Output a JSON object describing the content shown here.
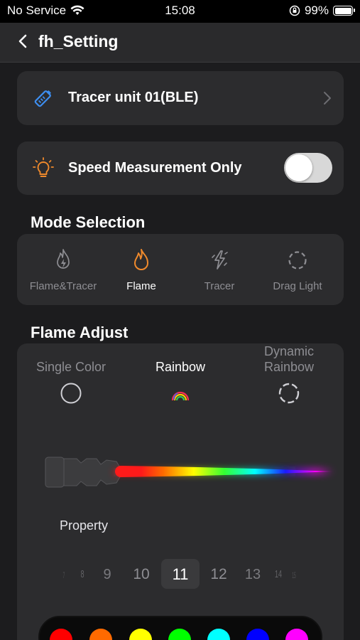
{
  "status_bar": {
    "carrier": "No Service",
    "time": "15:08",
    "battery": "99%"
  },
  "nav": {
    "title": "fh_Setting"
  },
  "device": {
    "name": "Tracer unit 01(BLE)"
  },
  "speed": {
    "label": "Speed Measurement Only",
    "enabled": false
  },
  "mode_section": {
    "title": "Mode Selection"
  },
  "modes": [
    {
      "label": "Flame&Tracer",
      "active": false
    },
    {
      "label": "Flame",
      "active": true
    },
    {
      "label": "Tracer",
      "active": false
    },
    {
      "label": "Drag Light",
      "active": false
    }
  ],
  "flame_section": {
    "title": "Flame Adjust"
  },
  "flame_options": {
    "single": "Single Color",
    "rainbow": "Rainbow",
    "dynamic_line1": "Dynamic",
    "dynamic_line2": "Rainbow",
    "selected": "Rainbow"
  },
  "property": {
    "label": "Property"
  },
  "picker": {
    "values": [
      "7",
      "8",
      "9",
      "10",
      "11",
      "12",
      "13",
      "14",
      "15"
    ],
    "selected": "11"
  },
  "palette": [
    "#ff0000",
    "#ff6a00",
    "#ffff00",
    "#00ff00",
    "#00ffff",
    "#0000ff",
    "#ff00ff"
  ],
  "colors": {
    "accent": "#f08a2c",
    "device_icon": "#3d8ef0",
    "card": "#2c2c2e",
    "background": "#1c1c1e"
  }
}
